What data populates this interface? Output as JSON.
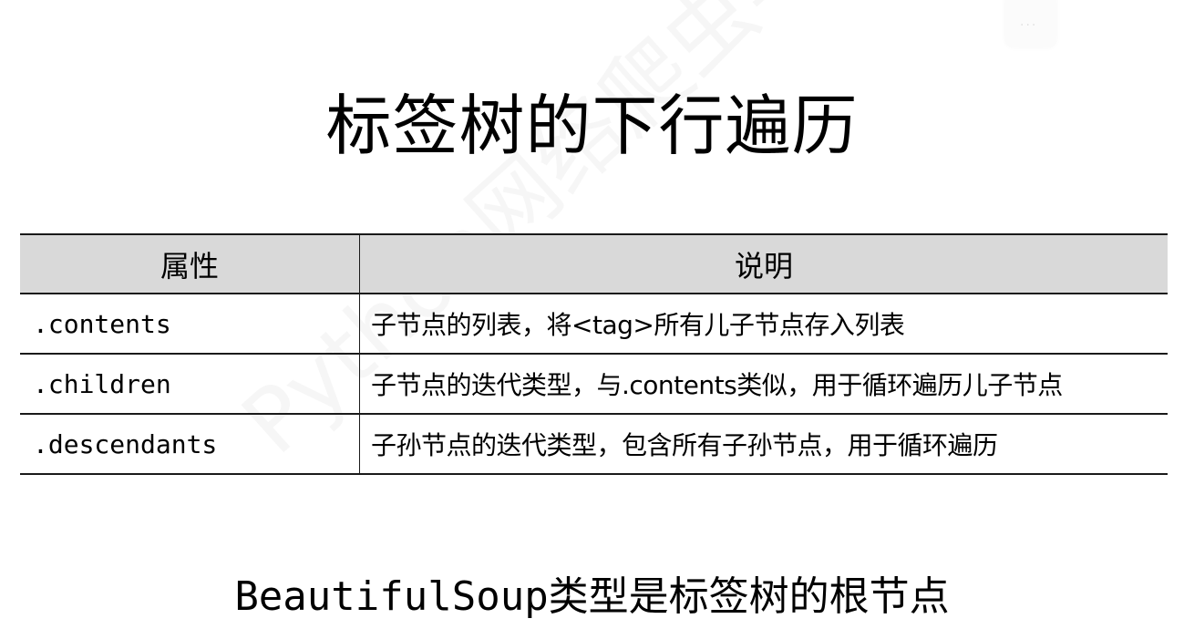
{
  "slide": {
    "title": "标签树的下行遍历",
    "watermark": "Python网络爬虫与信息提取",
    "corner_widget": {
      "icon": "more-icon",
      "label": "···"
    }
  },
  "table": {
    "headers": [
      "属性",
      "说明"
    ],
    "rows": [
      {
        "attr": ".contents",
        "desc": "子节点的列表，将<tag>所有儿子节点存入列表"
      },
      {
        "attr": ".children",
        "desc": "子节点的迭代类型，与.contents类似，用于循环遍历儿子节点"
      },
      {
        "attr": ".descendants",
        "desc": "子孙节点的迭代类型，包含所有子孙节点，用于循环遍历"
      }
    ]
  },
  "footer": {
    "text": "BeautifulSoup类型是标签树的根节点"
  },
  "colors": {
    "header_bg": "#d9d9d9",
    "border": "#1a1a1a",
    "text": "#000000"
  }
}
